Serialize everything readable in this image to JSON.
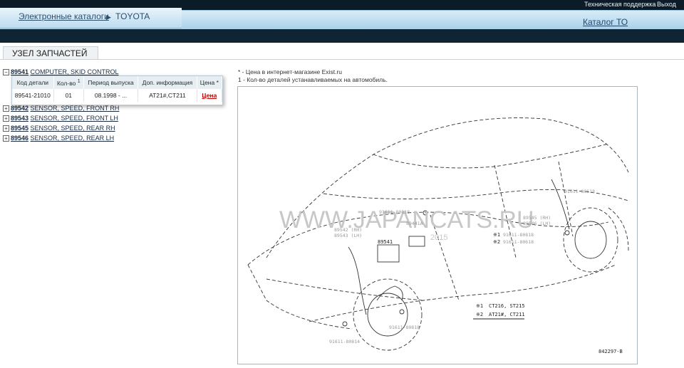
{
  "header": {
    "breadcrumb": [
      "Электронные каталоги",
      "TOYOTA"
    ],
    "support_link": "Техническая поддержка",
    "logout_link": "Выход",
    "catalog_to_link": "Каталог ТО"
  },
  "section": {
    "title": "УЗЕЛ ЗАПЧАСТЕЙ"
  },
  "tree": [
    {
      "code": "89541",
      "name": "COMPUTER, SKID CONTROL",
      "expanded": true
    },
    {
      "code": "89542",
      "name": "SENSOR, SPEED, FRONT RH"
    },
    {
      "code": "89543",
      "name": "SENSOR, SPEED, FRONT LH"
    },
    {
      "code": "89545",
      "name": "SENSOR, SPEED, REAR RH"
    },
    {
      "code": "89546",
      "name": "SENSOR, SPEED, REAR LH"
    }
  ],
  "parts_table": {
    "headers": [
      "Код детали",
      "Кол-во",
      "Период выпуска",
      "Доп. информация",
      "Цена"
    ],
    "qty_sup": "1",
    "price_sup": "*",
    "rows": [
      {
        "code": "89541-21010",
        "qty": "01",
        "period": "08.1998 - ...",
        "info": "AT21#,CT211",
        "price": "Цена"
      }
    ]
  },
  "notes": [
    "* - Цена в интернет-магазине Exist.ru",
    "1 - Кол-во деталей устанавливаемых на автомобиль."
  ],
  "diagram": {
    "watermark": "WWW.JAPANCATS.RU",
    "watermark_year": "2015",
    "labels": {
      "p89541": "89541",
      "p89542": "89542 (RH)",
      "p89543": "89543 (LH)",
      "p89441a": "89441A",
      "p89545": "89545 (RH)",
      "p89546": "89546 (LH)",
      "bolt_top": "91611-80818",
      "bolt_right": "91611-80618",
      "bolt_mid1": "91611-80818",
      "bolt_mid2": "91611-80618",
      "bolt_wheel": "91611-80818",
      "bolt_bottom": "91611-80814"
    },
    "legend": [
      {
        "mark": "※1",
        "text": "CT216, ST215"
      },
      {
        "mark": "※2",
        "text": "AT21#, CT211"
      }
    ],
    "side_marks": [
      "※1",
      "※2"
    ],
    "figure_number": "842297-B"
  }
}
